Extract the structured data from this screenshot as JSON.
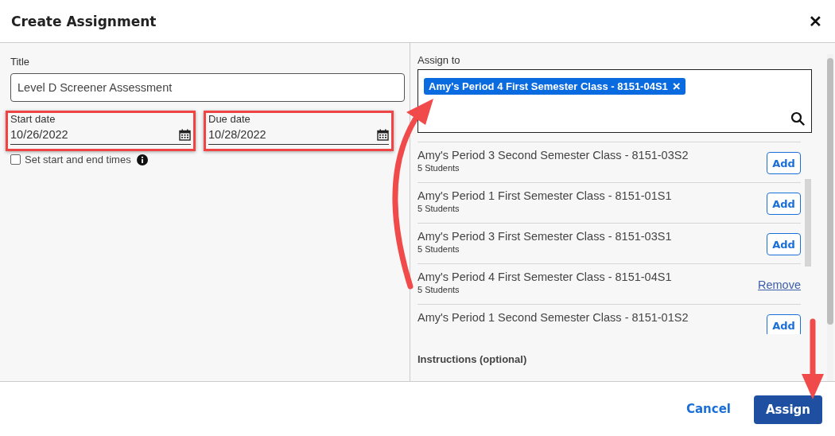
{
  "dialog": {
    "title": "Create Assignment",
    "close": "✕"
  },
  "form": {
    "title_label": "Title",
    "title_value": "Level D Screener Assessment",
    "dates": [
      {
        "label": "Start date",
        "value": "10/26/2022",
        "highlighted": true
      },
      {
        "label": "Due date",
        "value": "10/28/2022",
        "highlighted": true
      }
    ],
    "times_option": {
      "label": "Set start and end times",
      "checked": false
    }
  },
  "assign_to": {
    "label": "Assign to",
    "chips": [
      {
        "label": "Amy's Period 4 First Semester Class - 8151-04S1",
        "remove": "×"
      }
    ],
    "classes": [
      {
        "name": "Amy's Period 3 Second Semester Class - 8151-03S2",
        "students": "5 Students",
        "kind": "add",
        "action": "Add"
      },
      {
        "name": "Amy's Period 1 First Semester Class - 8151-01S1",
        "students": "5 Students",
        "kind": "add",
        "action": "Add"
      },
      {
        "name": "Amy's Period 3 First Semester Class - 8151-03S1",
        "students": "5 Students",
        "kind": "add",
        "action": "Add"
      },
      {
        "name": "Amy's Period 4 First Semester Class - 8151-04S1",
        "students": "5 Students",
        "kind": "remove",
        "action": "Remove"
      },
      {
        "name": "Amy's Period 1 Second Semester Class - 8151-01S2",
        "kind": "add",
        "action": "Add"
      }
    ],
    "instructions_label": "Instructions (optional)"
  },
  "footer": {
    "cancel": "Cancel",
    "submit": "Assign"
  }
}
